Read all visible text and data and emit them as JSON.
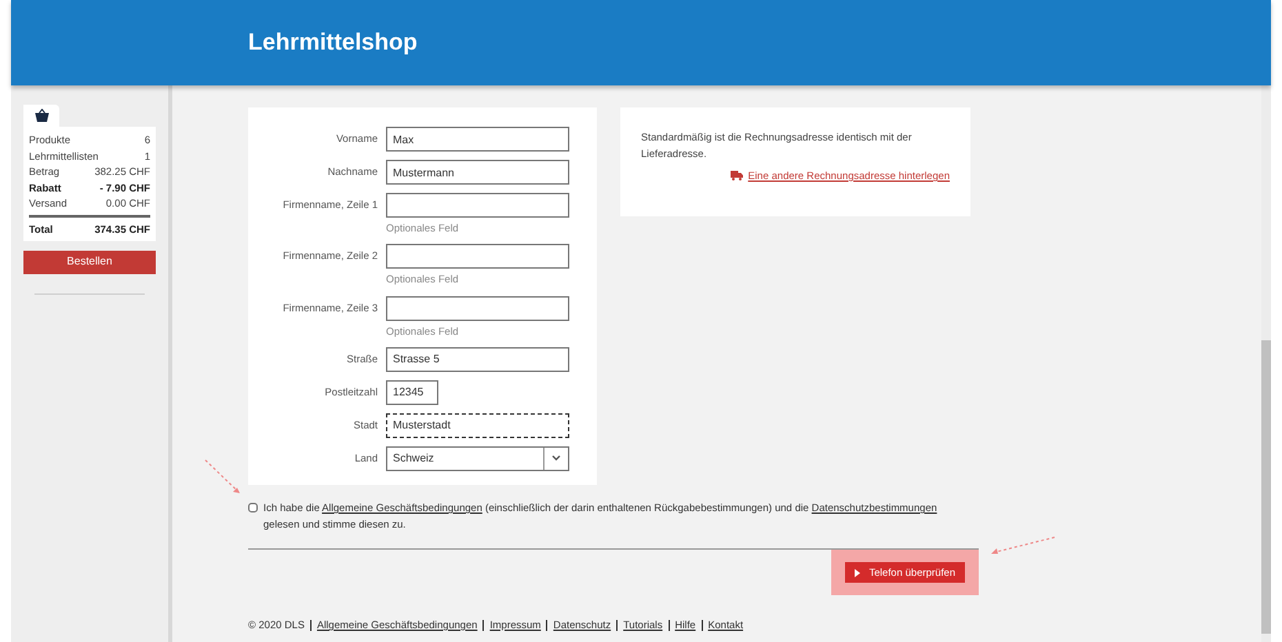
{
  "header": {
    "title": "Lehrmittelshop"
  },
  "cart": {
    "rows": [
      {
        "label": "Produkte",
        "value": "6",
        "bold": false
      },
      {
        "label": "Lehrmittellisten",
        "value": "1",
        "bold": false
      },
      {
        "label": "Betrag",
        "value": "382.25 CHF",
        "bold": false
      },
      {
        "label": "Rabatt",
        "value": "- 7.90 CHF",
        "bold": true
      },
      {
        "label": "Versand",
        "value": "0.00 CHF",
        "bold": false
      }
    ],
    "total": {
      "label": "Total",
      "value": "374.35 CHF"
    },
    "order_button": "Bestellen"
  },
  "form": {
    "fields": [
      {
        "kind": "input",
        "label": "Vorname",
        "value": "Max",
        "focused": false
      },
      {
        "kind": "input",
        "label": "Nachname",
        "value": "Mustermann",
        "focused": false
      },
      {
        "kind": "input",
        "label": "Firmenname, Zeile 1",
        "hint": "Optionales Feld",
        "focused": false
      },
      {
        "kind": "input",
        "label": "Firmenname, Zeile 2",
        "hint": "Optionales Feld",
        "focused": false
      },
      {
        "kind": "input",
        "label": "Firmenname, Zeile 3",
        "hint": "Optionales Feld",
        "focused": false
      },
      {
        "kind": "input",
        "label": "Straße",
        "value": "Strasse 5",
        "focused": false
      },
      {
        "kind": "short",
        "label": "Postleitzahl",
        "value": "12345",
        "focused": false
      },
      {
        "kind": "input",
        "label": "Stadt",
        "value": "Musterstadt",
        "focused": true
      },
      {
        "kind": "select",
        "label": "Land",
        "value": "Schweiz",
        "focused": false
      }
    ]
  },
  "billing": {
    "text": "Standardmäßig ist die Rechnungsadresse identisch mit der Lieferadresse.",
    "link": "Eine andere Rechnungsadresse hinterlegen"
  },
  "terms": {
    "checked": false,
    "parts": [
      "Ich habe die ",
      "Allgemeine Geschäftsbedingungen",
      " (einschließlich der darin enthaltenen Rückgabebestimmungen) und die ",
      "Datenschutzbestimmungen",
      " gelesen und stimme diesen zu."
    ]
  },
  "submit_button": "Telefon überprüfen",
  "footer": {
    "copyright": "© 2020 DLS",
    "links": [
      "Allgemeine Geschäftsbedingungen",
      "Impressum",
      "Datenschutz",
      "Tutorials",
      "Hilfe",
      "Kontakt"
    ]
  }
}
